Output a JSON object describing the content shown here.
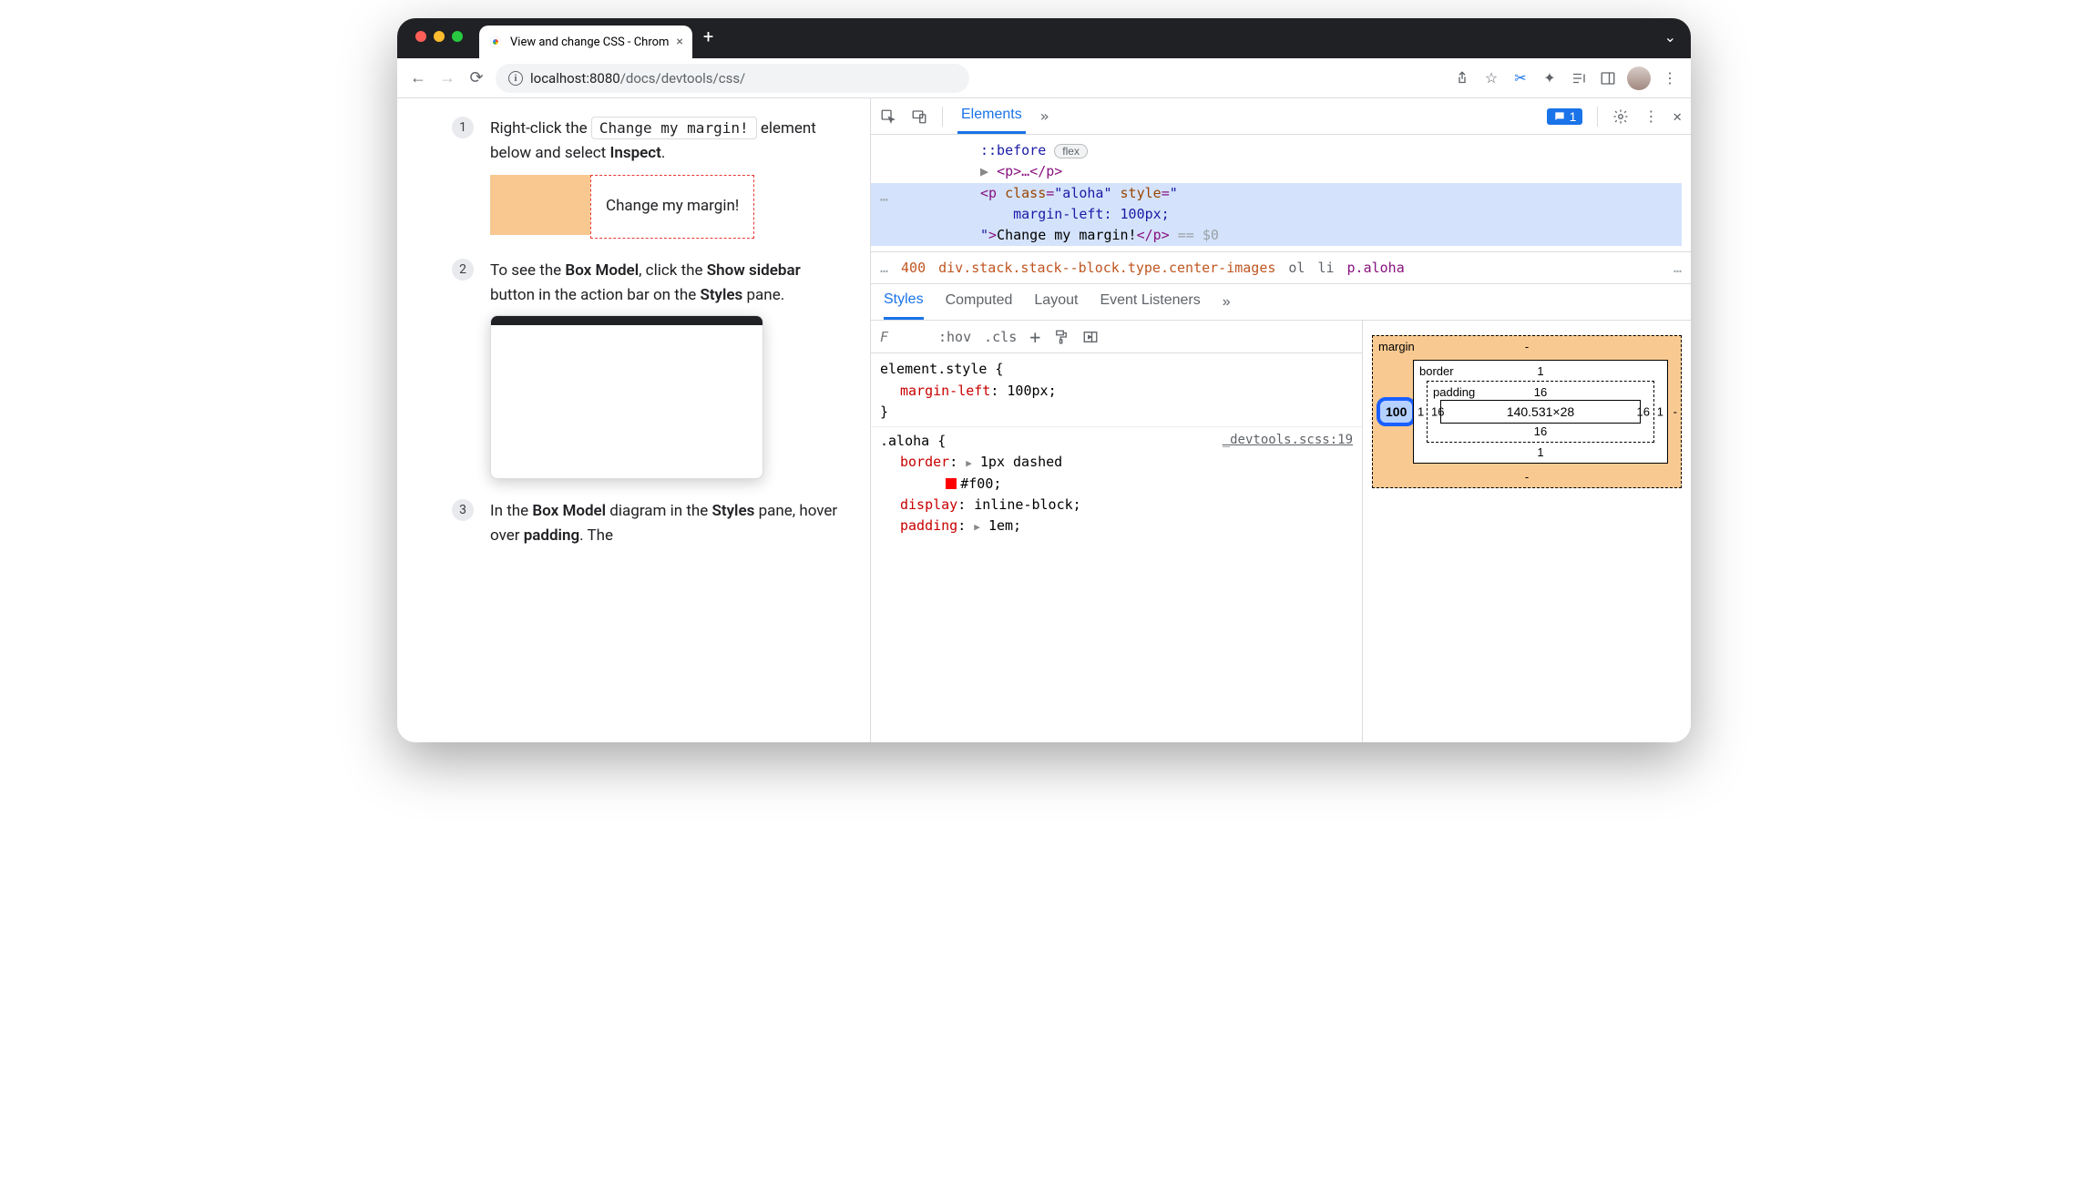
{
  "window": {
    "tab_title": "View and change CSS - Chrom",
    "url_host": "localhost:",
    "url_port": "8080",
    "url_path": "/docs/devtools/css/"
  },
  "docs": {
    "steps": [
      {
        "num": "1",
        "pre": "Right-click the ",
        "code": "Change my margin!",
        "post": " element below and select ",
        "bold": "Inspect",
        "tail": "."
      },
      {
        "num": "2",
        "text_parts": [
          "To see the ",
          "Box Model",
          ", click the ",
          "Show sidebar",
          " button in the action bar on the ",
          "Styles",
          " pane."
        ]
      },
      {
        "num": "3",
        "text_parts": [
          "In the ",
          "Box Model",
          " diagram in the ",
          "Styles",
          " pane, hover over ",
          "padding",
          ". The"
        ]
      }
    ],
    "demo_text": "Change my margin!"
  },
  "devtools": {
    "main_tabs": {
      "elements": "Elements"
    },
    "msg_count": "1",
    "dom": {
      "pseudo": "::before",
      "flex_pill": "flex",
      "p_collapsed": "<p>…</p>",
      "sel_open1": "<p ",
      "sel_class_k": "class",
      "sel_class_v": "\"aloha\"",
      "sel_style_k": "style",
      "sel_style_v_open": "\"",
      "sel_style_rule": "margin-left: 100px;",
      "sel_style_v_close": "\"",
      "sel_text": "Change my margin!",
      "sel_close": "</p>",
      "eq": "== $0"
    },
    "crumbs": {
      "dots": "…",
      "t00": "400",
      "main": "div.stack.stack--block.type.center-images",
      "ol": "ol",
      "li": "li",
      "paloha": "p.aloha",
      "dots2": "…"
    },
    "styles_tabs": [
      "Styles",
      "Computed",
      "Layout",
      "Event Listeners"
    ],
    "filter": {
      "placeholder": "F",
      "hov": ":hov",
      "cls": ".cls"
    },
    "rules": {
      "el_style": "element.style {",
      "el_prop": "margin-left",
      "el_val": "100px",
      "aloha_sel": ".aloha {",
      "aloha_link": "_devtools.scss:19",
      "border_prop": "border",
      "border_val": "1px dashed",
      "border_color": "#f00",
      "display_prop": "display",
      "display_val": "inline-block",
      "padding_prop": "padding",
      "padding_val": "1em"
    },
    "boxmodel": {
      "margin_label": "margin",
      "border_label": "border",
      "padding_label": "padding",
      "margin": {
        "top": "-",
        "right": "-",
        "bottom": "-",
        "left": "100"
      },
      "border": {
        "top": "1",
        "right": "1",
        "bottom": "1",
        "left": "1"
      },
      "padding": {
        "top": "16",
        "right": "16",
        "bottom": "16",
        "left": "16"
      },
      "content": "140.531×28"
    }
  }
}
